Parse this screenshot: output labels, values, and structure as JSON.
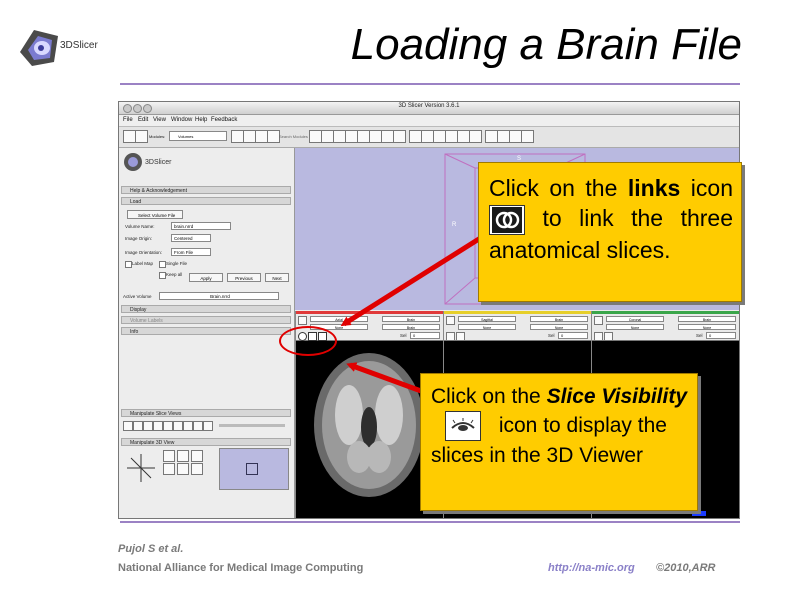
{
  "slide": {
    "title": "Loading a Brain File",
    "logo_text": "3DSlicer",
    "footer_author": "Pujol S et al.",
    "footer_org": "National Alliance for Medical Image Computing",
    "footer_url": "http://na-mic.org",
    "footer_copyright": "©2010,ARR"
  },
  "window": {
    "title": "3D Slicer Version 3.6.1",
    "menu": [
      "File",
      "Edit",
      "View",
      "Window",
      "Help",
      "Feedback"
    ],
    "modules_label": "Modules:",
    "modules_value": "Volumes",
    "search_label": "Search Modules"
  },
  "left_panel": {
    "logo_text": "3DSlicer",
    "sections": {
      "help": "Help & Acknowledgement",
      "load": "Load",
      "display": "Display",
      "volume_labels": "Volume Labels",
      "info": "Info",
      "manipulate_slice": "Manipulate Slice Views",
      "manipulate_3d": "Manipulate 3D View"
    },
    "load": {
      "select_file": "Select Volume File",
      "volume_name_label": "Volume Name:",
      "volume_name_value": "brain.nrrd",
      "image_origin_label": "Image Origin:",
      "image_origin_value": "Centered",
      "image_orientation_label": "Image Orientation:",
      "image_orientation_value": "From File",
      "label_map": "Label Map",
      "single_file": "Single File",
      "keep_all": "Keep all",
      "apply": "Apply",
      "previous": "Previous",
      "next": "Next"
    },
    "active_volume_label": "Active Volume",
    "active_volume_value": "Brain.nrrd"
  },
  "view3d": {
    "r_label": "R",
    "s_label": "S"
  },
  "viewers": [
    {
      "color": "#e03a3a",
      "select_a": "Axial",
      "select_b": "Brain",
      "select_c": "None",
      "select_d": "Brain",
      "sel_label": "Sel",
      "sel_value": "0"
    },
    {
      "color": "#e6cf2a",
      "select_a": "Sagittal",
      "select_b": "Brain",
      "select_c": "None",
      "select_d": "None",
      "sel_label": "Sel",
      "sel_value": "0"
    },
    {
      "color": "#3aa64a",
      "select_a": "Coronal",
      "select_b": "Brain",
      "select_c": "None",
      "select_d": "None",
      "sel_label": "Sel",
      "sel_value": "0"
    }
  ],
  "callouts": {
    "links": {
      "part1": "Click on the ",
      "bold": "links",
      "part2": " icon ",
      "part3": " to link the three anatomical slices."
    },
    "visibility": {
      "part1": "Click on the ",
      "bold_italic": "Slice Visibility",
      "part2": " icon to display the slices in the 3D Viewer"
    }
  },
  "colors": {
    "callout_fill": "#ffcc00",
    "arrow": "#e00000",
    "rule": "#9b82c4",
    "view3d": "#b9b9e0"
  }
}
